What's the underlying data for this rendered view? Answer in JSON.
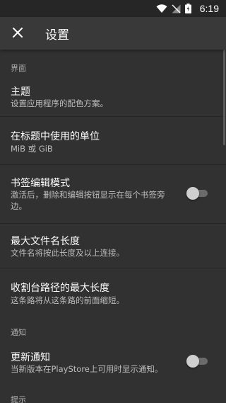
{
  "status_bar": {
    "time": "6:19",
    "icons": [
      "wifi-icon",
      "signal-off-icon",
      "battery-icon"
    ]
  },
  "app_bar": {
    "close_icon": "close-icon",
    "title": "设置"
  },
  "sections": {
    "ui": "界面",
    "notification": "通知",
    "tips": "提示"
  },
  "preferences": {
    "theme": {
      "title": "主题",
      "summary": "设置应用程序的配色方案。"
    },
    "unit": {
      "title": "在标题中使用的单位",
      "summary": "MiB 或 GiB"
    },
    "bookmark_edit": {
      "title": "书签编辑模式",
      "summary": "激活后，删除和编辑按钮显示在每个书签旁边。",
      "enabled": false
    },
    "max_filename": {
      "title": "最大文件名长度",
      "summary": "文件名将按此长度及以上连接。"
    },
    "max_path": {
      "title": "收割台路径的最大长度",
      "summary": "这条路将从这条路的前面缩短。"
    },
    "update_notify": {
      "title": "更新通知",
      "summary": "当新版本在PlayStore上可用时显示通知。",
      "enabled": false
    }
  },
  "colors": {
    "background": "#313131",
    "app_bar": "#393939",
    "status_bar": "#262626",
    "secondary_text": "#bdbdbd"
  }
}
